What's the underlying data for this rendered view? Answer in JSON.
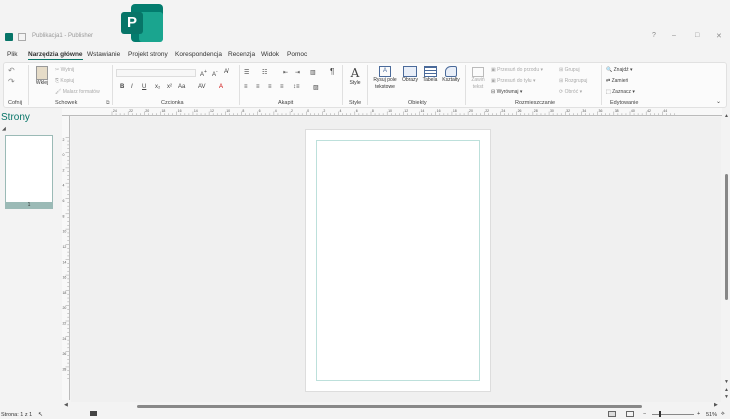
{
  "title": {
    "app_name": "Publisher",
    "doc_name": "Publikacja1",
    "separator": "-",
    "win_min": "–",
    "win_max": "□",
    "win_close": "✕",
    "help": "?"
  },
  "menu": {
    "items": [
      "Plik",
      "Narzędzia główne",
      "Wstawianie",
      "Projekt strony",
      "Korespondencja",
      "Recenzja",
      "Widok",
      "Pomoc"
    ],
    "active_index": 1
  },
  "ribbon": {
    "groups": {
      "undo": "Cofnij",
      "clipboard": "Schowek",
      "font": "Czcionka",
      "paragraph": "Akapit",
      "styles": "Style",
      "objects": "Obiekty",
      "arrange": "Rozmieszczanie",
      "editing": "Edytowanie"
    },
    "clipboard": {
      "paste": "Wklej",
      "cut": "Wytnij",
      "copy": "Kopiuj",
      "format_painter": "Malarz formatów"
    },
    "styles_btn": "Style",
    "objects": {
      "text_box": "Rysuj pole tekstowe",
      "pictures": "Obrazy",
      "table": "Tabela",
      "shapes": "Kształty"
    },
    "arrange": {
      "wrap_text": "Zawiń tekst",
      "bring_forward": "Przesuń do przodu",
      "send_backward": "Przesuń do tyłu",
      "align": "Wyrównaj",
      "group": "Grupuj",
      "ungroup": "Rozgrupuj",
      "rotate": "Obróć"
    },
    "editing": {
      "find": "Znajdź",
      "replace": "Zamień",
      "select": "Zaznacz"
    }
  },
  "pages_pane": {
    "title": "Strony",
    "thumb_number": "1"
  },
  "ruler_h_labels": [
    "24",
    "22",
    "20",
    "18",
    "16",
    "14",
    "12",
    "10",
    "8",
    "6",
    "4",
    "2",
    "0",
    "2",
    "4",
    "6",
    "8",
    "10",
    "12",
    "14",
    "16",
    "18",
    "20",
    "22",
    "24",
    "26",
    "28",
    "30",
    "32",
    "34",
    "36",
    "38",
    "40",
    "42",
    "44"
  ],
  "ruler_v_labels": [
    "2",
    "0",
    "2",
    "4",
    "6",
    "8",
    "10",
    "12",
    "14",
    "16",
    "18",
    "20",
    "22",
    "24",
    "26",
    "28",
    "30"
  ],
  "status": {
    "page": "Strona: 1 z 1",
    "zoom": "51%"
  }
}
